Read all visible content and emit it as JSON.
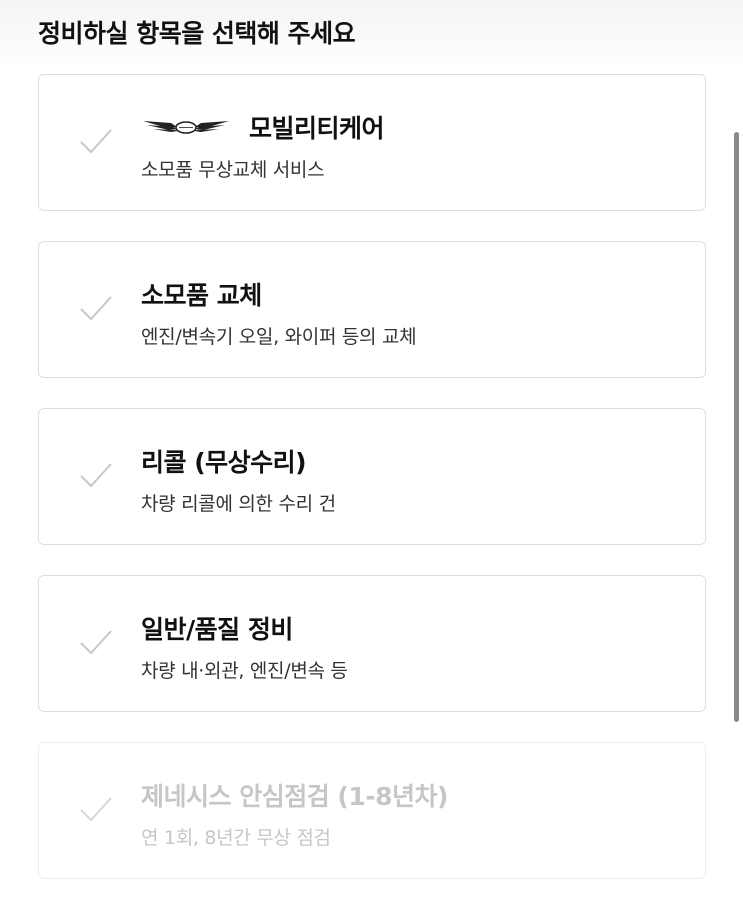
{
  "header": {
    "title": "정비하실 항목을 선택해 주세요"
  },
  "options": [
    {
      "title": "모빌리티케어",
      "description": "소모품 무상교체 서비스",
      "icon": "genesis-wings-logo",
      "disabled": false
    },
    {
      "title": "소모품 교체",
      "description": "엔진/변속기 오일, 와이퍼 등의 교체",
      "disabled": false
    },
    {
      "title": "리콜 (무상수리)",
      "description": "차량 리콜에 의한 수리 건",
      "disabled": false
    },
    {
      "title": "일반/품질 정비",
      "description": "차량 내·외관, 엔진/변속 등",
      "disabled": false
    },
    {
      "title": "제네시스 안심점검 (1-8년차)",
      "description": "연 1회, 8년간 무상 점검",
      "disabled": true
    }
  ],
  "colors": {
    "check": "#c8c8c8",
    "border": "#dedede",
    "disabled_text": "#c6c6c6",
    "scrollbar": "#8a8a8a"
  }
}
